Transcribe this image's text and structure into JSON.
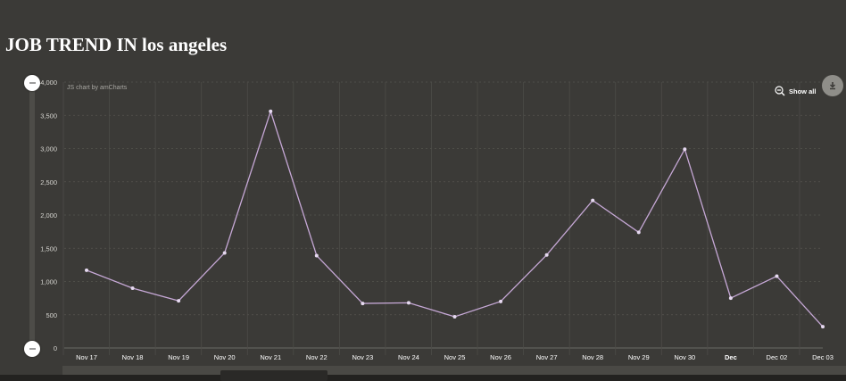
{
  "page": {
    "title": "JOB TREND IN los angeles"
  },
  "chart_data": {
    "type": "line",
    "credit": "JS chart by amCharts",
    "show_all_label": "Show all",
    "categories": [
      "Nov 17",
      "Nov 18",
      "Nov 19",
      "Nov 20",
      "Nov 21",
      "Nov 22",
      "Nov 23",
      "Nov 24",
      "Nov 25",
      "Nov 26",
      "Nov 27",
      "Nov 28",
      "Nov 29",
      "Nov 30",
      "Dec",
      "Dec 02",
      "Dec 03"
    ],
    "bold_categories": [
      "Dec"
    ],
    "values": [
      1170,
      900,
      710,
      1430,
      3560,
      1390,
      670,
      680,
      470,
      700,
      1400,
      2220,
      1740,
      2990,
      750,
      1080,
      320
    ],
    "yticks": [
      "0",
      "500",
      "1,000",
      "1,500",
      "2,000",
      "2,500",
      "3,000",
      "3,500",
      "4,000"
    ],
    "ylim": [
      0,
      4000
    ],
    "grid": true,
    "line_color": "#c6a8d6",
    "point_color": "#e6d9f0"
  },
  "icons": {
    "zoom": "zoom-out-icon",
    "download": "download-icon"
  }
}
